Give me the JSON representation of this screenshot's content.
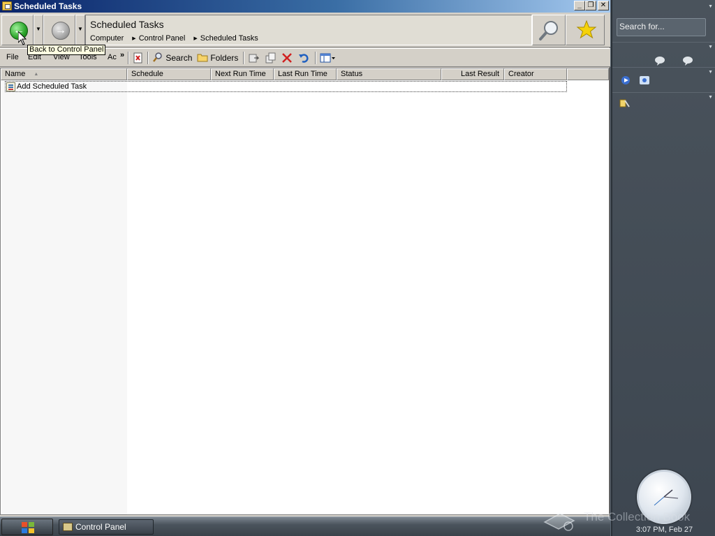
{
  "window": {
    "title": "Scheduled Tasks",
    "minimize_glyph": "_",
    "restore_glyph": "❐",
    "close_glyph": "✕"
  },
  "navigation": {
    "back_tooltip": "Back to Control Panel",
    "address_title": "Scheduled Tasks",
    "breadcrumb": [
      "Computer",
      "Control Panel",
      "Scheduled Tasks"
    ]
  },
  "menu": {
    "file": "File",
    "edit": "Edit",
    "view": "View",
    "tools": "Tools",
    "advanced": "Ac",
    "overflow": "»"
  },
  "toolbar": {
    "search_label": "Search",
    "folders_label": "Folders"
  },
  "list": {
    "columns": {
      "name": "Name",
      "schedule": "Schedule",
      "next_run": "Next Run Time",
      "last_run": "Last Run Time",
      "status": "Status",
      "last_result": "Last Result",
      "creator": "Creator"
    },
    "items": [
      {
        "name": "Add Scheduled Task"
      }
    ]
  },
  "sidebar": {
    "search_placeholder": "Search for...",
    "clock_time": "3:07 PM, Feb 27"
  },
  "taskbar": {
    "active_task": "Control Panel",
    "watermark": "The Collection Book"
  },
  "colors": {
    "title_gradient_start": "#0a246a",
    "title_gradient_end": "#a6caf0",
    "chrome": "#d4d0c8",
    "sidebar_bg": "#4a535c",
    "tooltip_bg": "#ffffe1"
  }
}
